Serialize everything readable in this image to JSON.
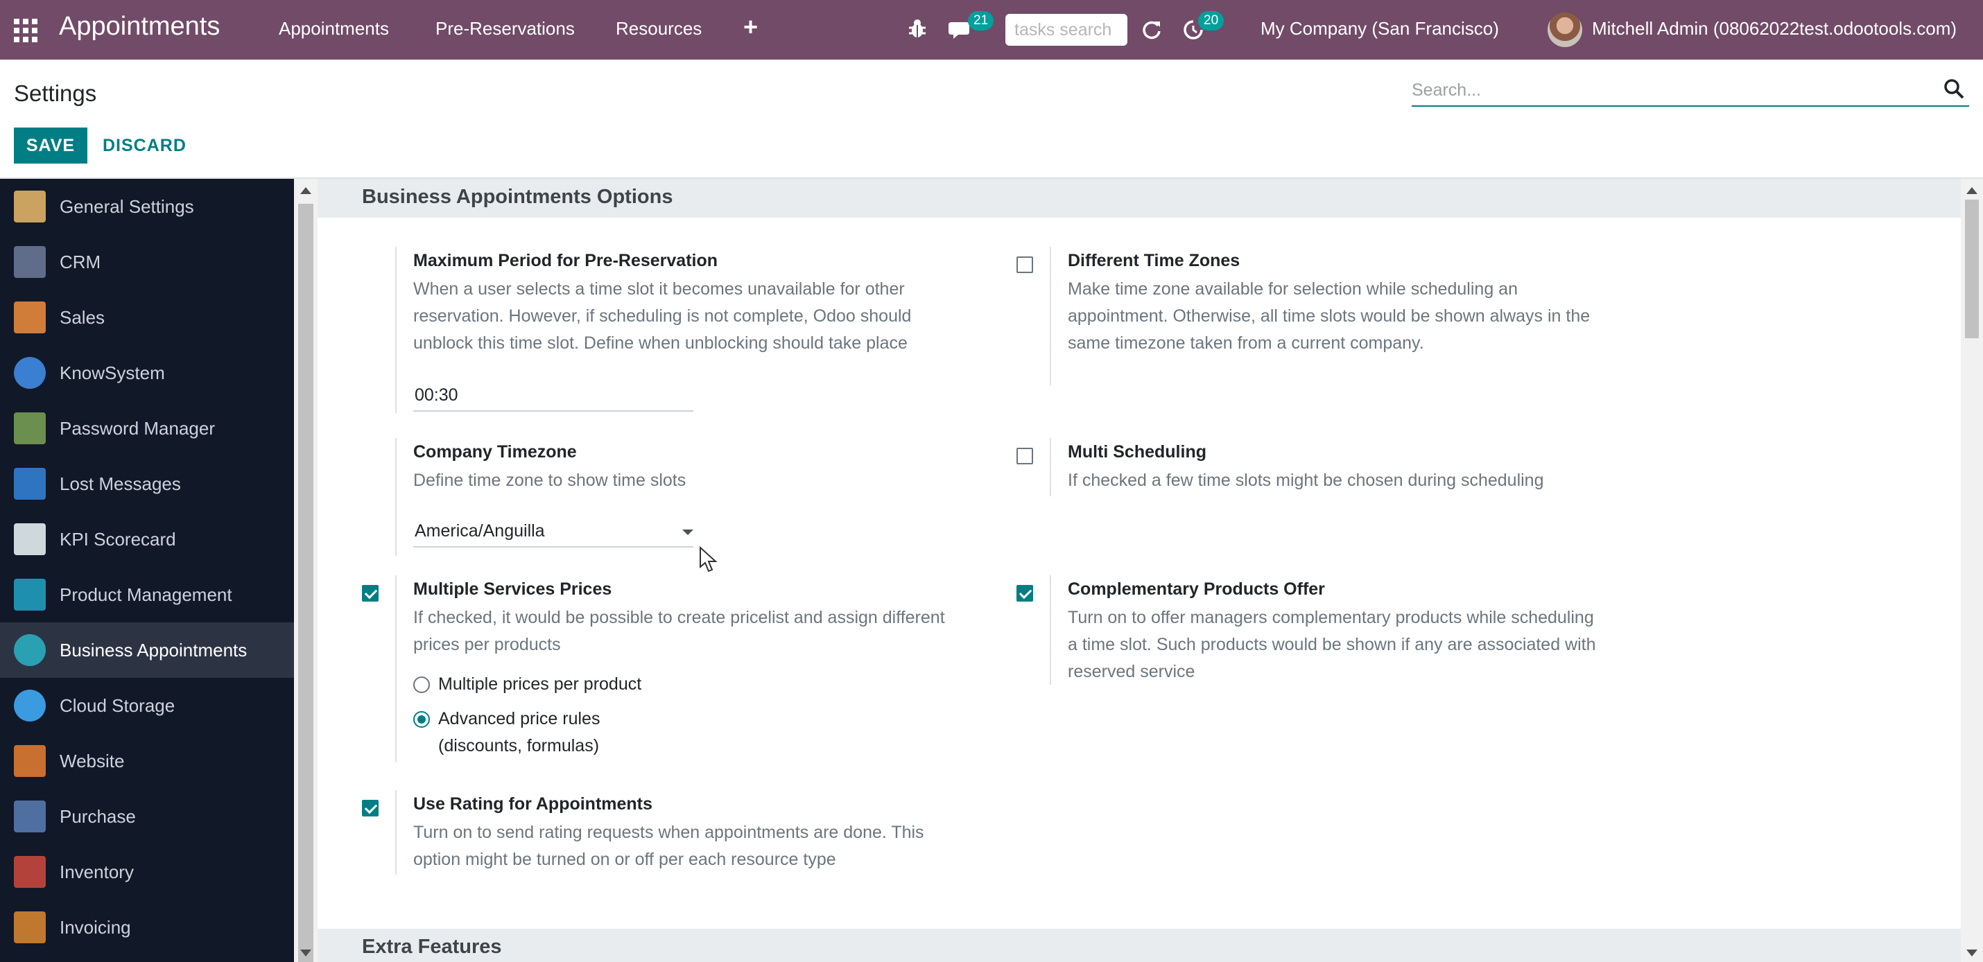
{
  "navbar": {
    "app_title": "Appointments",
    "menu": [
      "Appointments",
      "Pre-Reservations",
      "Resources"
    ],
    "add_symbol": "+",
    "chat_badge": "21",
    "activity_badge": "20",
    "tasks_search_placeholder": "tasks search",
    "company": "My Company (San Francisco)",
    "user": "Mitchell Admin (08062022test.odootools.com)"
  },
  "control_panel": {
    "title": "Settings",
    "search_placeholder": "Search...",
    "save_label": "SAVE",
    "discard_label": "DISCARD"
  },
  "sidebar": {
    "items": [
      {
        "label": "General Settings",
        "icon": "gear-icon",
        "color": "#c9a35f"
      },
      {
        "label": "CRM",
        "icon": "handshake-icon",
        "color": "#5f6c8a"
      },
      {
        "label": "Sales",
        "icon": "chart-icon",
        "color": "#d17d3a"
      },
      {
        "label": "KnowSystem",
        "icon": "brain-icon",
        "color": "#3a7fd1"
      },
      {
        "label": "Password Manager",
        "icon": "tools-icon",
        "color": "#6a8f4f"
      },
      {
        "label": "Lost Messages",
        "icon": "person-icon",
        "color": "#2f74c0"
      },
      {
        "label": "KPI Scorecard",
        "icon": "document-icon",
        "color": "#cfd8dc"
      },
      {
        "label": "Product Management",
        "icon": "grid-icon",
        "color": "#1f8fb0"
      },
      {
        "label": "Business Appointments",
        "icon": "clock-icon",
        "color": "#2aa1b3"
      },
      {
        "label": "Cloud Storage",
        "icon": "cloud-icon",
        "color": "#3b9be0"
      },
      {
        "label": "Website",
        "icon": "globe-icon",
        "color": "#c8702f"
      },
      {
        "label": "Purchase",
        "icon": "card-icon",
        "color": "#4f6fa0"
      },
      {
        "label": "Inventory",
        "icon": "box-icon",
        "color": "#b3433a"
      },
      {
        "label": "Invoicing",
        "icon": "invoice-icon",
        "color": "#c0782e"
      }
    ]
  },
  "sections": {
    "business": {
      "title": "Business Appointments Options",
      "max_period": {
        "title": "Maximum Period for Pre-Reservation",
        "desc": [
          "When a user selects a time slot it becomes unavailable for other",
          "reservation. However, if scheduling is not complete, Odoo should",
          "unblock this time slot. Define when unblocking should take place"
        ],
        "value": "00:30"
      },
      "time_zones": {
        "title": "Different Time Zones",
        "desc": [
          "Make time zone available for selection while scheduling an",
          "appointment. Otherwise, all time slots would be shown always in the",
          "same timezone taken from a current company."
        ]
      },
      "company_tz": {
        "title": "Company Timezone",
        "desc": [
          "Define time zone to show time slots"
        ],
        "value": "America/Anguilla"
      },
      "multi_sched": {
        "title": "Multi Scheduling",
        "desc": [
          "If checked a few time slots might be chosen during scheduling"
        ]
      },
      "multi_prices": {
        "title": "Multiple Services Prices",
        "desc": [
          "If checked, it would be possible to create pricelist and assign different",
          "prices per products"
        ],
        "option1": "Multiple prices per product",
        "option2_line1": "Advanced price rules",
        "option2_line2": "(discounts, formulas)"
      },
      "compl_products": {
        "title": "Complementary Products Offer",
        "desc": [
          "Turn on to offer managers complementary products while scheduling",
          "a time slot. Such products would be shown if any are associated with",
          "reserved service"
        ]
      },
      "rating": {
        "title": "Use Rating for Appointments",
        "desc": [
          "Turn on to send rating requests when appointments are done. This",
          "option might be turned on or off per each resource type"
        ]
      }
    },
    "extra": {
      "title": "Extra Features"
    }
  }
}
